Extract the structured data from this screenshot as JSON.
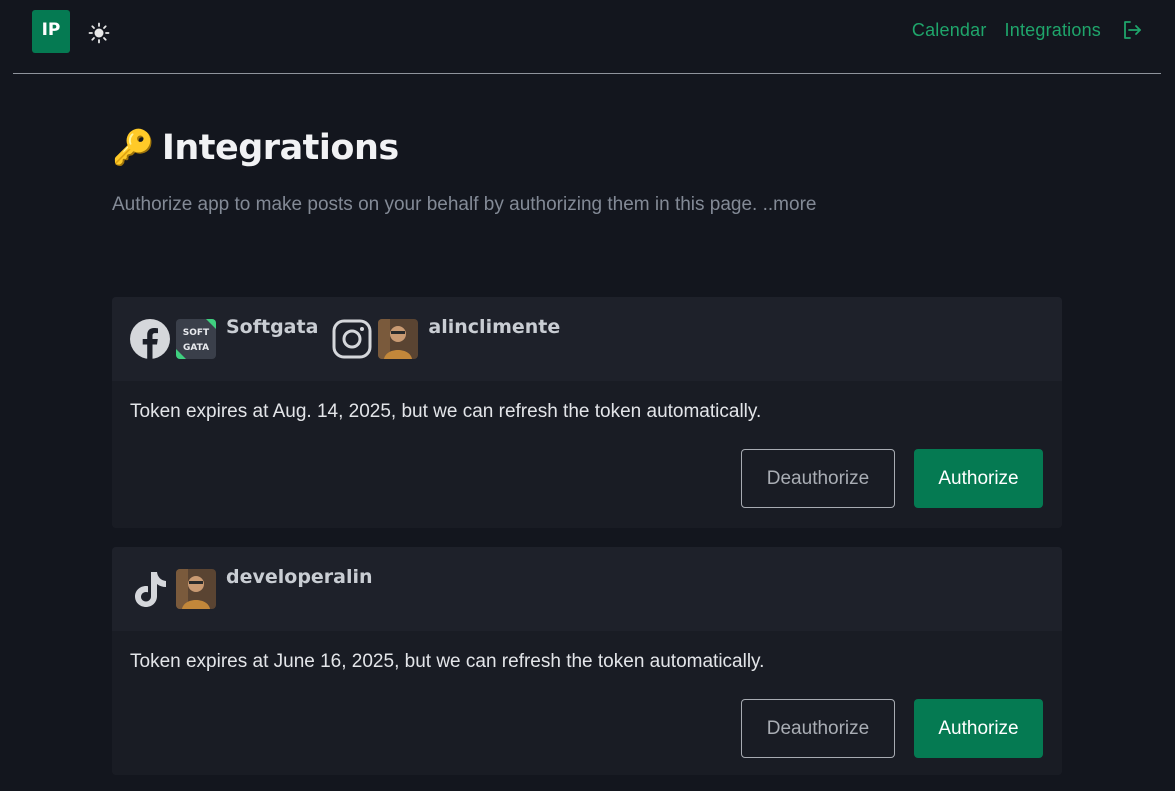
{
  "header": {
    "logo_text": "IP",
    "theme_icon": "sun-icon",
    "nav": [
      {
        "label": "Calendar"
      },
      {
        "label": "Integrations"
      }
    ],
    "logout_icon": "logout-icon",
    "accent_color": "#1fa56b"
  },
  "page": {
    "title_icon": "🔑",
    "title": "Integrations",
    "subtitle": "Authorize app to make posts on your behalf by authorizing them in this page. ..more"
  },
  "integrations": [
    {
      "accounts": [
        {
          "platform": "facebook-icon",
          "name": "Softgata",
          "avatar_text_1": "SOFT",
          "avatar_text_2": "GATA"
        },
        {
          "platform": "instagram-icon",
          "name": "alinclimente"
        }
      ],
      "token_text": "Token expires at Aug. 14, 2025, but we can refresh the token automatically.",
      "deauthorize_label": "Deauthorize",
      "authorize_label": "Authorize"
    },
    {
      "accounts": [
        {
          "platform": "tiktok-icon",
          "name": "developeralin"
        }
      ],
      "token_text": "Token expires at June 16, 2025, but we can refresh the token automatically.",
      "deauthorize_label": "Deauthorize",
      "authorize_label": "Authorize"
    }
  ],
  "colors": {
    "background": "#13161e",
    "card": "#1c1f28",
    "primary_button": "#057a52"
  }
}
